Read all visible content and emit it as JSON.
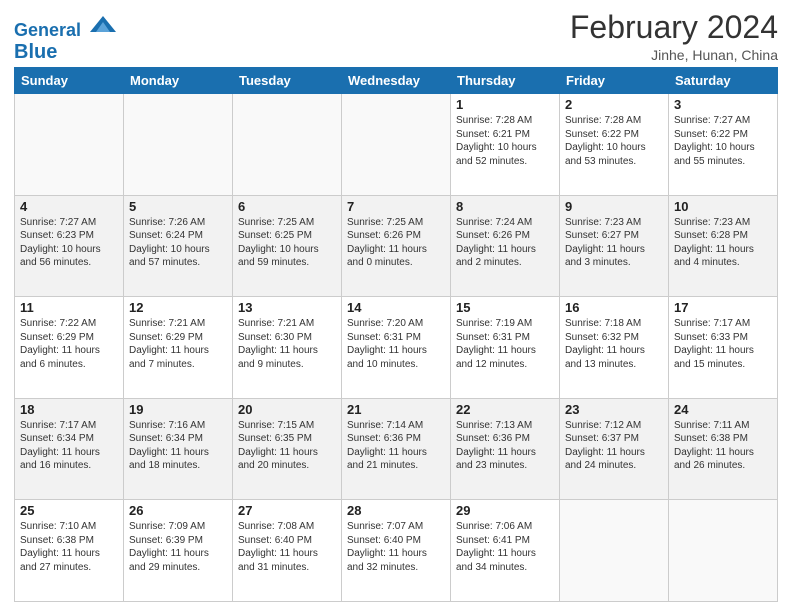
{
  "header": {
    "logo_line1": "General",
    "logo_line2": "Blue",
    "title": "February 2024",
    "subtitle": "Jinhe, Hunan, China"
  },
  "days_of_week": [
    "Sunday",
    "Monday",
    "Tuesday",
    "Wednesday",
    "Thursday",
    "Friday",
    "Saturday"
  ],
  "weeks": [
    [
      {
        "day": "",
        "info": ""
      },
      {
        "day": "",
        "info": ""
      },
      {
        "day": "",
        "info": ""
      },
      {
        "day": "",
        "info": ""
      },
      {
        "day": "1",
        "info": "Sunrise: 7:28 AM\nSunset: 6:21 PM\nDaylight: 10 hours and 52 minutes."
      },
      {
        "day": "2",
        "info": "Sunrise: 7:28 AM\nSunset: 6:22 PM\nDaylight: 10 hours and 53 minutes."
      },
      {
        "day": "3",
        "info": "Sunrise: 7:27 AM\nSunset: 6:22 PM\nDaylight: 10 hours and 55 minutes."
      }
    ],
    [
      {
        "day": "4",
        "info": "Sunrise: 7:27 AM\nSunset: 6:23 PM\nDaylight: 10 hours and 56 minutes."
      },
      {
        "day": "5",
        "info": "Sunrise: 7:26 AM\nSunset: 6:24 PM\nDaylight: 10 hours and 57 minutes."
      },
      {
        "day": "6",
        "info": "Sunrise: 7:25 AM\nSunset: 6:25 PM\nDaylight: 10 hours and 59 minutes."
      },
      {
        "day": "7",
        "info": "Sunrise: 7:25 AM\nSunset: 6:26 PM\nDaylight: 11 hours and 0 minutes."
      },
      {
        "day": "8",
        "info": "Sunrise: 7:24 AM\nSunset: 6:26 PM\nDaylight: 11 hours and 2 minutes."
      },
      {
        "day": "9",
        "info": "Sunrise: 7:23 AM\nSunset: 6:27 PM\nDaylight: 11 hours and 3 minutes."
      },
      {
        "day": "10",
        "info": "Sunrise: 7:23 AM\nSunset: 6:28 PM\nDaylight: 11 hours and 4 minutes."
      }
    ],
    [
      {
        "day": "11",
        "info": "Sunrise: 7:22 AM\nSunset: 6:29 PM\nDaylight: 11 hours and 6 minutes."
      },
      {
        "day": "12",
        "info": "Sunrise: 7:21 AM\nSunset: 6:29 PM\nDaylight: 11 hours and 7 minutes."
      },
      {
        "day": "13",
        "info": "Sunrise: 7:21 AM\nSunset: 6:30 PM\nDaylight: 11 hours and 9 minutes."
      },
      {
        "day": "14",
        "info": "Sunrise: 7:20 AM\nSunset: 6:31 PM\nDaylight: 11 hours and 10 minutes."
      },
      {
        "day": "15",
        "info": "Sunrise: 7:19 AM\nSunset: 6:31 PM\nDaylight: 11 hours and 12 minutes."
      },
      {
        "day": "16",
        "info": "Sunrise: 7:18 AM\nSunset: 6:32 PM\nDaylight: 11 hours and 13 minutes."
      },
      {
        "day": "17",
        "info": "Sunrise: 7:17 AM\nSunset: 6:33 PM\nDaylight: 11 hours and 15 minutes."
      }
    ],
    [
      {
        "day": "18",
        "info": "Sunrise: 7:17 AM\nSunset: 6:34 PM\nDaylight: 11 hours and 16 minutes."
      },
      {
        "day": "19",
        "info": "Sunrise: 7:16 AM\nSunset: 6:34 PM\nDaylight: 11 hours and 18 minutes."
      },
      {
        "day": "20",
        "info": "Sunrise: 7:15 AM\nSunset: 6:35 PM\nDaylight: 11 hours and 20 minutes."
      },
      {
        "day": "21",
        "info": "Sunrise: 7:14 AM\nSunset: 6:36 PM\nDaylight: 11 hours and 21 minutes."
      },
      {
        "day": "22",
        "info": "Sunrise: 7:13 AM\nSunset: 6:36 PM\nDaylight: 11 hours and 23 minutes."
      },
      {
        "day": "23",
        "info": "Sunrise: 7:12 AM\nSunset: 6:37 PM\nDaylight: 11 hours and 24 minutes."
      },
      {
        "day": "24",
        "info": "Sunrise: 7:11 AM\nSunset: 6:38 PM\nDaylight: 11 hours and 26 minutes."
      }
    ],
    [
      {
        "day": "25",
        "info": "Sunrise: 7:10 AM\nSunset: 6:38 PM\nDaylight: 11 hours and 27 minutes."
      },
      {
        "day": "26",
        "info": "Sunrise: 7:09 AM\nSunset: 6:39 PM\nDaylight: 11 hours and 29 minutes."
      },
      {
        "day": "27",
        "info": "Sunrise: 7:08 AM\nSunset: 6:40 PM\nDaylight: 11 hours and 31 minutes."
      },
      {
        "day": "28",
        "info": "Sunrise: 7:07 AM\nSunset: 6:40 PM\nDaylight: 11 hours and 32 minutes."
      },
      {
        "day": "29",
        "info": "Sunrise: 7:06 AM\nSunset: 6:41 PM\nDaylight: 11 hours and 34 minutes."
      },
      {
        "day": "",
        "info": ""
      },
      {
        "day": "",
        "info": ""
      }
    ]
  ]
}
